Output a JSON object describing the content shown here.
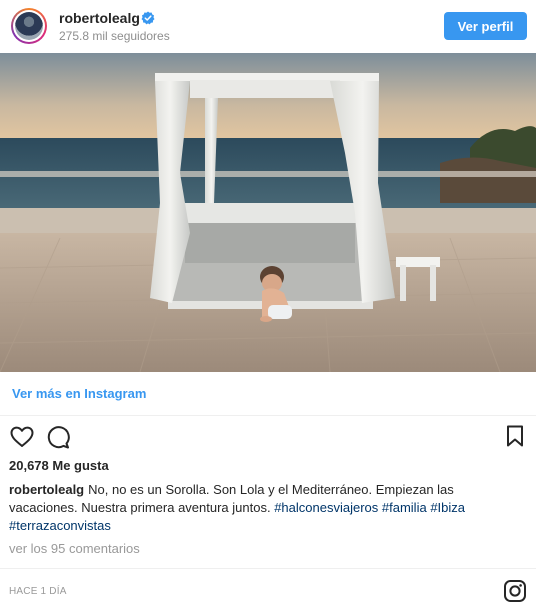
{
  "header": {
    "username": "robertolealg",
    "followers": "275.8 mil seguidores",
    "view_profile_label": "Ver perfil",
    "verified_color": "#3897f0"
  },
  "photo": {
    "scene": "baby-on-terrace-cabana-sea-view"
  },
  "view_more": "Ver más en Instagram",
  "actions": {
    "icons": [
      "heart-icon",
      "comment-icon",
      "bookmark-icon"
    ]
  },
  "likes": "20,678 Me gusta",
  "caption": {
    "username": "robertolealg",
    "text": "No, no es un Sorolla. Son Lola y el Mediterráneo. Empiezan las vacaciones. Nuestra primera aventura juntos. ",
    "hashtags": [
      "#halconesviajeros",
      "#familia",
      "#Ibiza",
      "#terrazaconvistas"
    ]
  },
  "comments_link": "ver los 95 comentarios",
  "footer": {
    "time": "HACE 1 DÍA"
  },
  "colors": {
    "accent": "#3897f0",
    "hashtag": "#003569",
    "muted": "#999999"
  }
}
